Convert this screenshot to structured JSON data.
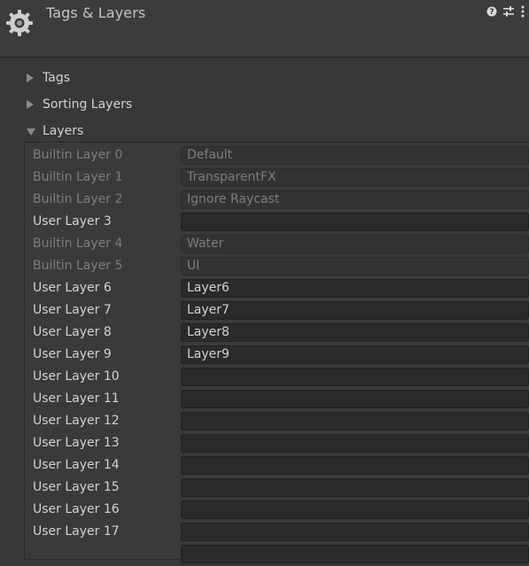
{
  "window": {
    "title": "Tags & Layers",
    "icons": [
      "gear-icon",
      "help-icon",
      "preset-icon",
      "more-menu-icon"
    ]
  },
  "sections": {
    "tags": {
      "label": "Tags",
      "expanded": false
    },
    "sorting_layers": {
      "label": "Sorting Layers",
      "expanded": false
    },
    "layers": {
      "label": "Layers",
      "expanded": true
    }
  },
  "layers": [
    {
      "label": "Builtin Layer 0",
      "value": "Default",
      "builtin": true
    },
    {
      "label": "Builtin Layer 1",
      "value": "TransparentFX",
      "builtin": true
    },
    {
      "label": "Builtin Layer 2",
      "value": "Ignore Raycast",
      "builtin": true
    },
    {
      "label": "User Layer 3",
      "value": "",
      "builtin": false
    },
    {
      "label": "Builtin Layer 4",
      "value": "Water",
      "builtin": true
    },
    {
      "label": "Builtin Layer 5",
      "value": "UI",
      "builtin": true
    },
    {
      "label": "User Layer 6",
      "value": "Layer6",
      "builtin": false
    },
    {
      "label": "User Layer 7",
      "value": "Layer7",
      "builtin": false
    },
    {
      "label": "User Layer 8",
      "value": "Layer8",
      "builtin": false
    },
    {
      "label": "User Layer 9",
      "value": "Layer9",
      "builtin": false
    },
    {
      "label": "User Layer 10",
      "value": "",
      "builtin": false
    },
    {
      "label": "User Layer 11",
      "value": "",
      "builtin": false
    },
    {
      "label": "User Layer 12",
      "value": "",
      "builtin": false
    },
    {
      "label": "User Layer 13",
      "value": "",
      "builtin": false
    },
    {
      "label": "User Layer 14",
      "value": "",
      "builtin": false
    },
    {
      "label": "User Layer 15",
      "value": "",
      "builtin": false
    },
    {
      "label": "User Layer 16",
      "value": "",
      "builtin": false
    },
    {
      "label": "User Layer 17",
      "value": "",
      "builtin": false
    },
    {
      "label": "",
      "value": "",
      "builtin": false
    }
  ]
}
